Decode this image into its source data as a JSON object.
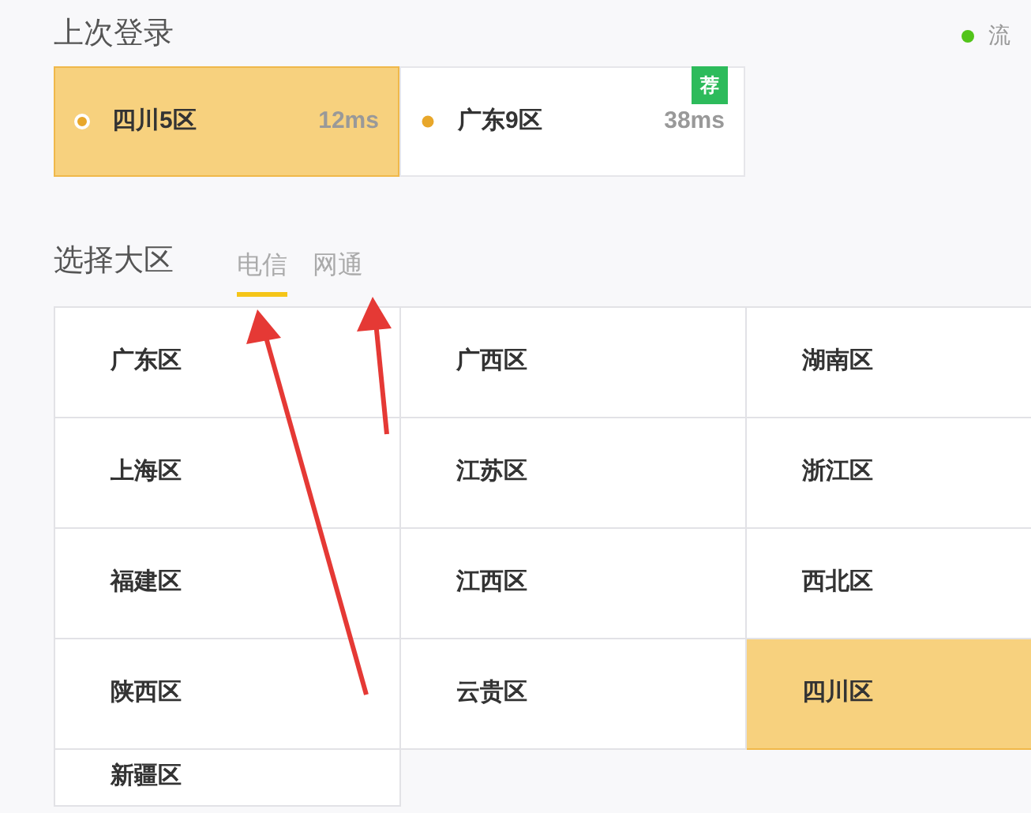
{
  "status": {
    "label": "流",
    "color": "#52c41a"
  },
  "last_login": {
    "title": "上次登录",
    "servers": [
      {
        "name": "四川5区",
        "ping": "12ms",
        "selected": true
      },
      {
        "name": "广东9区",
        "ping": "38ms",
        "selected": false,
        "badge": "荐"
      }
    ]
  },
  "region_picker": {
    "title": "选择大区",
    "tabs": [
      {
        "label": "电信",
        "selected": true
      },
      {
        "label": "网通",
        "selected": false
      }
    ],
    "regions": [
      {
        "name": "广东区",
        "selected": false
      },
      {
        "name": "广西区",
        "selected": false
      },
      {
        "name": "湖南区",
        "selected": false
      },
      {
        "name": "上海区",
        "selected": false
      },
      {
        "name": "江苏区",
        "selected": false
      },
      {
        "name": "浙江区",
        "selected": false
      },
      {
        "name": "福建区",
        "selected": false
      },
      {
        "name": "江西区",
        "selected": false
      },
      {
        "name": "西北区",
        "selected": false
      },
      {
        "name": "陕西区",
        "selected": false
      },
      {
        "name": "云贵区",
        "selected": false
      },
      {
        "name": "四川区",
        "selected": true
      },
      {
        "name": "新疆区",
        "selected": false
      }
    ]
  }
}
